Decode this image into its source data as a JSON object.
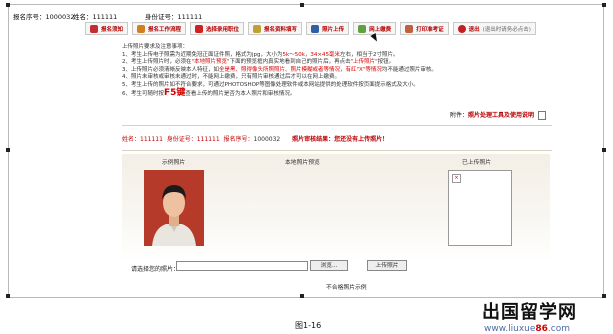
{
  "header": {
    "exam_no_label": "报名序号：",
    "exam_no": "1000032",
    "name_label": "姓名：",
    "name": "111111",
    "id_label": "身份证号：",
    "id": "111111"
  },
  "nav": [
    {
      "label": "报名须知",
      "icon": "info-icon",
      "color": "#c03030"
    },
    {
      "label": "报名工作流程",
      "icon": "flow-icon",
      "color": "#d08020"
    },
    {
      "label": "选择录用职位",
      "icon": "position-icon",
      "color": "#d02020"
    },
    {
      "label": "报名资料填写",
      "icon": "form-icon",
      "color": "#c0a030"
    },
    {
      "label": "照片上传",
      "icon": "photo-upload-icon",
      "color": "#3060a0"
    },
    {
      "label": "网上缴费",
      "icon": "payment-icon",
      "color": "#60a040"
    },
    {
      "label": "打印准考证",
      "icon": "printer-icon",
      "color": "#c06040"
    },
    {
      "label": "退出",
      "paren": "(退出时请务必点击)",
      "icon": "exit-icon",
      "color": "#c02020"
    }
  ],
  "notes": {
    "heading": "上传照片要求及注意事项：",
    "n1a": "1、考生上传电子照需为近期免冠正面证件照，格式为jpg，大小为",
    "n1b": "5k～50k，34×45毫米",
    "n1c": "左右，相当于2寸照片。",
    "n2a": "2、考生上传照片时，必须在",
    "n2b": "\"本地照片预览\"",
    "n2c": "下面的预览框内真实地看到自己的照片后，再点击",
    "n2d": "\"上传照片\"",
    "n2e": "按钮。",
    "n3a": "3、上传照片必须清晰反映本人特征，如",
    "n3b": "全是黑、照得像头所照照片、照片模糊或者等情况，有红\"X\"等情况",
    "n3c": "均不能通过照片审核。",
    "n4": "4、照片未审核或审核未通过时，不能网上缴费，只有照片审核通过后才可以在网上缴费。",
    "n5": "5、考生上传的照片如不符合要求，可通过PHOTOSHOP等图像处理软件或本网站提供的处理软件按页面提示格式及大小。",
    "n6a": "6、考生可随时按",
    "n6b": "F5键",
    "n6c": "查看上传的照片是否为本人照片和审核情况。"
  },
  "attachment": {
    "label": "附件：",
    "link": "照片处理工具及使用说明"
  },
  "status": {
    "name_label": "姓名：",
    "name": "111111",
    "id_label": "身份证号：",
    "id": "111111",
    "regno_label": "报名序号：",
    "regno": "1000032",
    "result": "照片审核结果：您还没有上传照片！"
  },
  "columns": {
    "sample": "示例照片",
    "local_preview": "本地照片预览",
    "uploaded": "已上传照片"
  },
  "upload": {
    "choose_label": "请选择您的照片：",
    "file_value": "",
    "browse_label": "浏览...",
    "upload_label": "上传照片"
  },
  "bad_sample": "不合格照片示例",
  "watermark": {
    "main": "出国留学网",
    "site_prefix": "www.liuxue",
    "site_num": "86",
    "site_suffix": ".com"
  },
  "caption": "图1-16"
}
